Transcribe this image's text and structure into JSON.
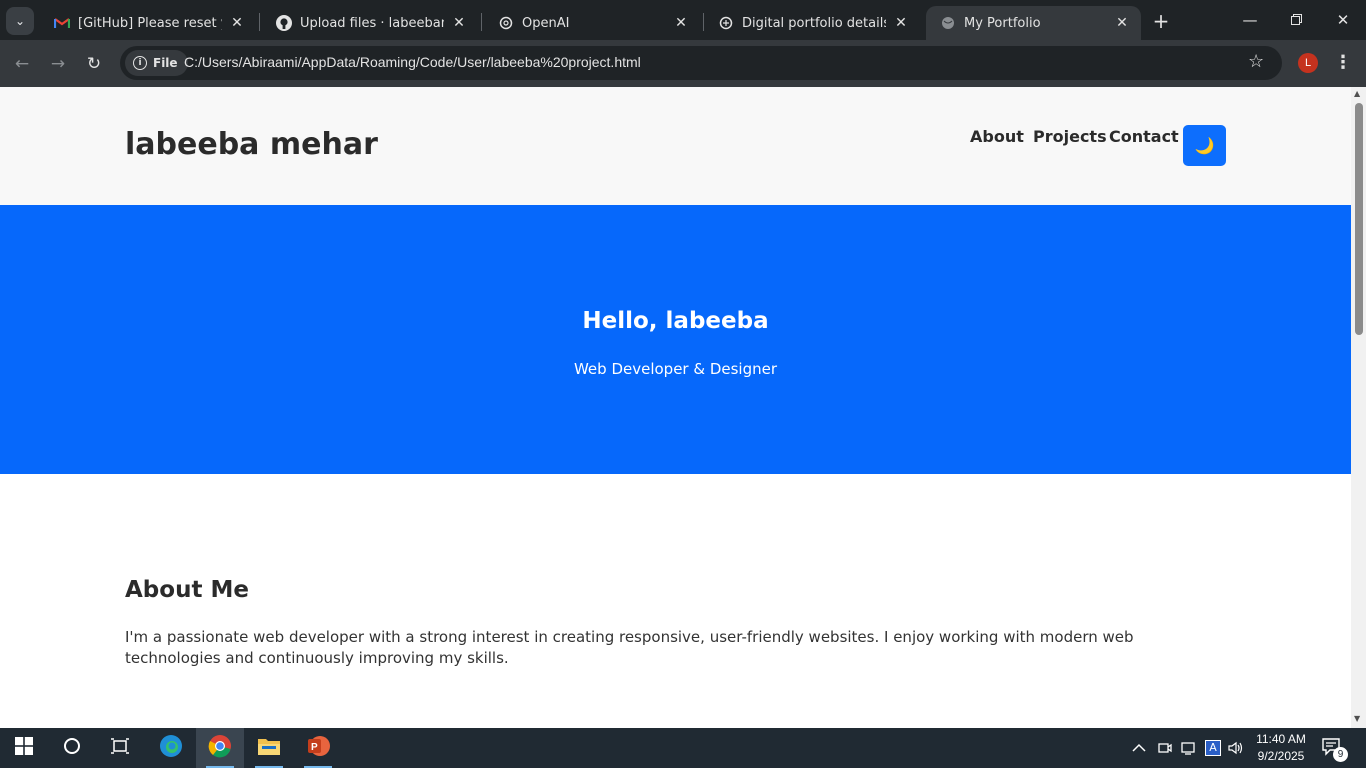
{
  "browser": {
    "tabs": [
      {
        "title": "[GitHub] Please reset your pa",
        "favicon": "gmail-icon",
        "active": false
      },
      {
        "title": "Upload files · labeebamehar",
        "favicon": "github-icon",
        "active": false
      },
      {
        "title": "OpenAI",
        "favicon": "openai-icon",
        "active": false
      },
      {
        "title": "Digital portfolio details",
        "favicon": "chatgpt-icon",
        "active": false
      },
      {
        "title": "My Portfolio",
        "favicon": "globe-icon",
        "active": true
      }
    ],
    "address_chip": "File",
    "url": "C:/Users/Abiraami/AppData/Roaming/Code/User/labeeba%20project.html",
    "profile_initial": "L"
  },
  "site": {
    "brand": "labeeba mehar",
    "nav": [
      "About",
      "Projects",
      "Contact"
    ],
    "theme_toggle_icon": "🌙",
    "hero": {
      "title": "Hello, labeeba",
      "subtitle": "Web Developer & Designer"
    },
    "about": {
      "title": "About Me",
      "text": "I'm a passionate web developer with a strong interest in creating responsive, user-friendly websites. I enjoy working with modern web technologies and continuously improving my skills."
    },
    "colors": {
      "accent": "#0668fb",
      "header_bg": "#f8f8f8",
      "text": "#2b2b2b"
    }
  },
  "taskbar": {
    "time": "11:40 AM",
    "date": "9/2/2025",
    "notification_count": "9",
    "language": "A"
  }
}
